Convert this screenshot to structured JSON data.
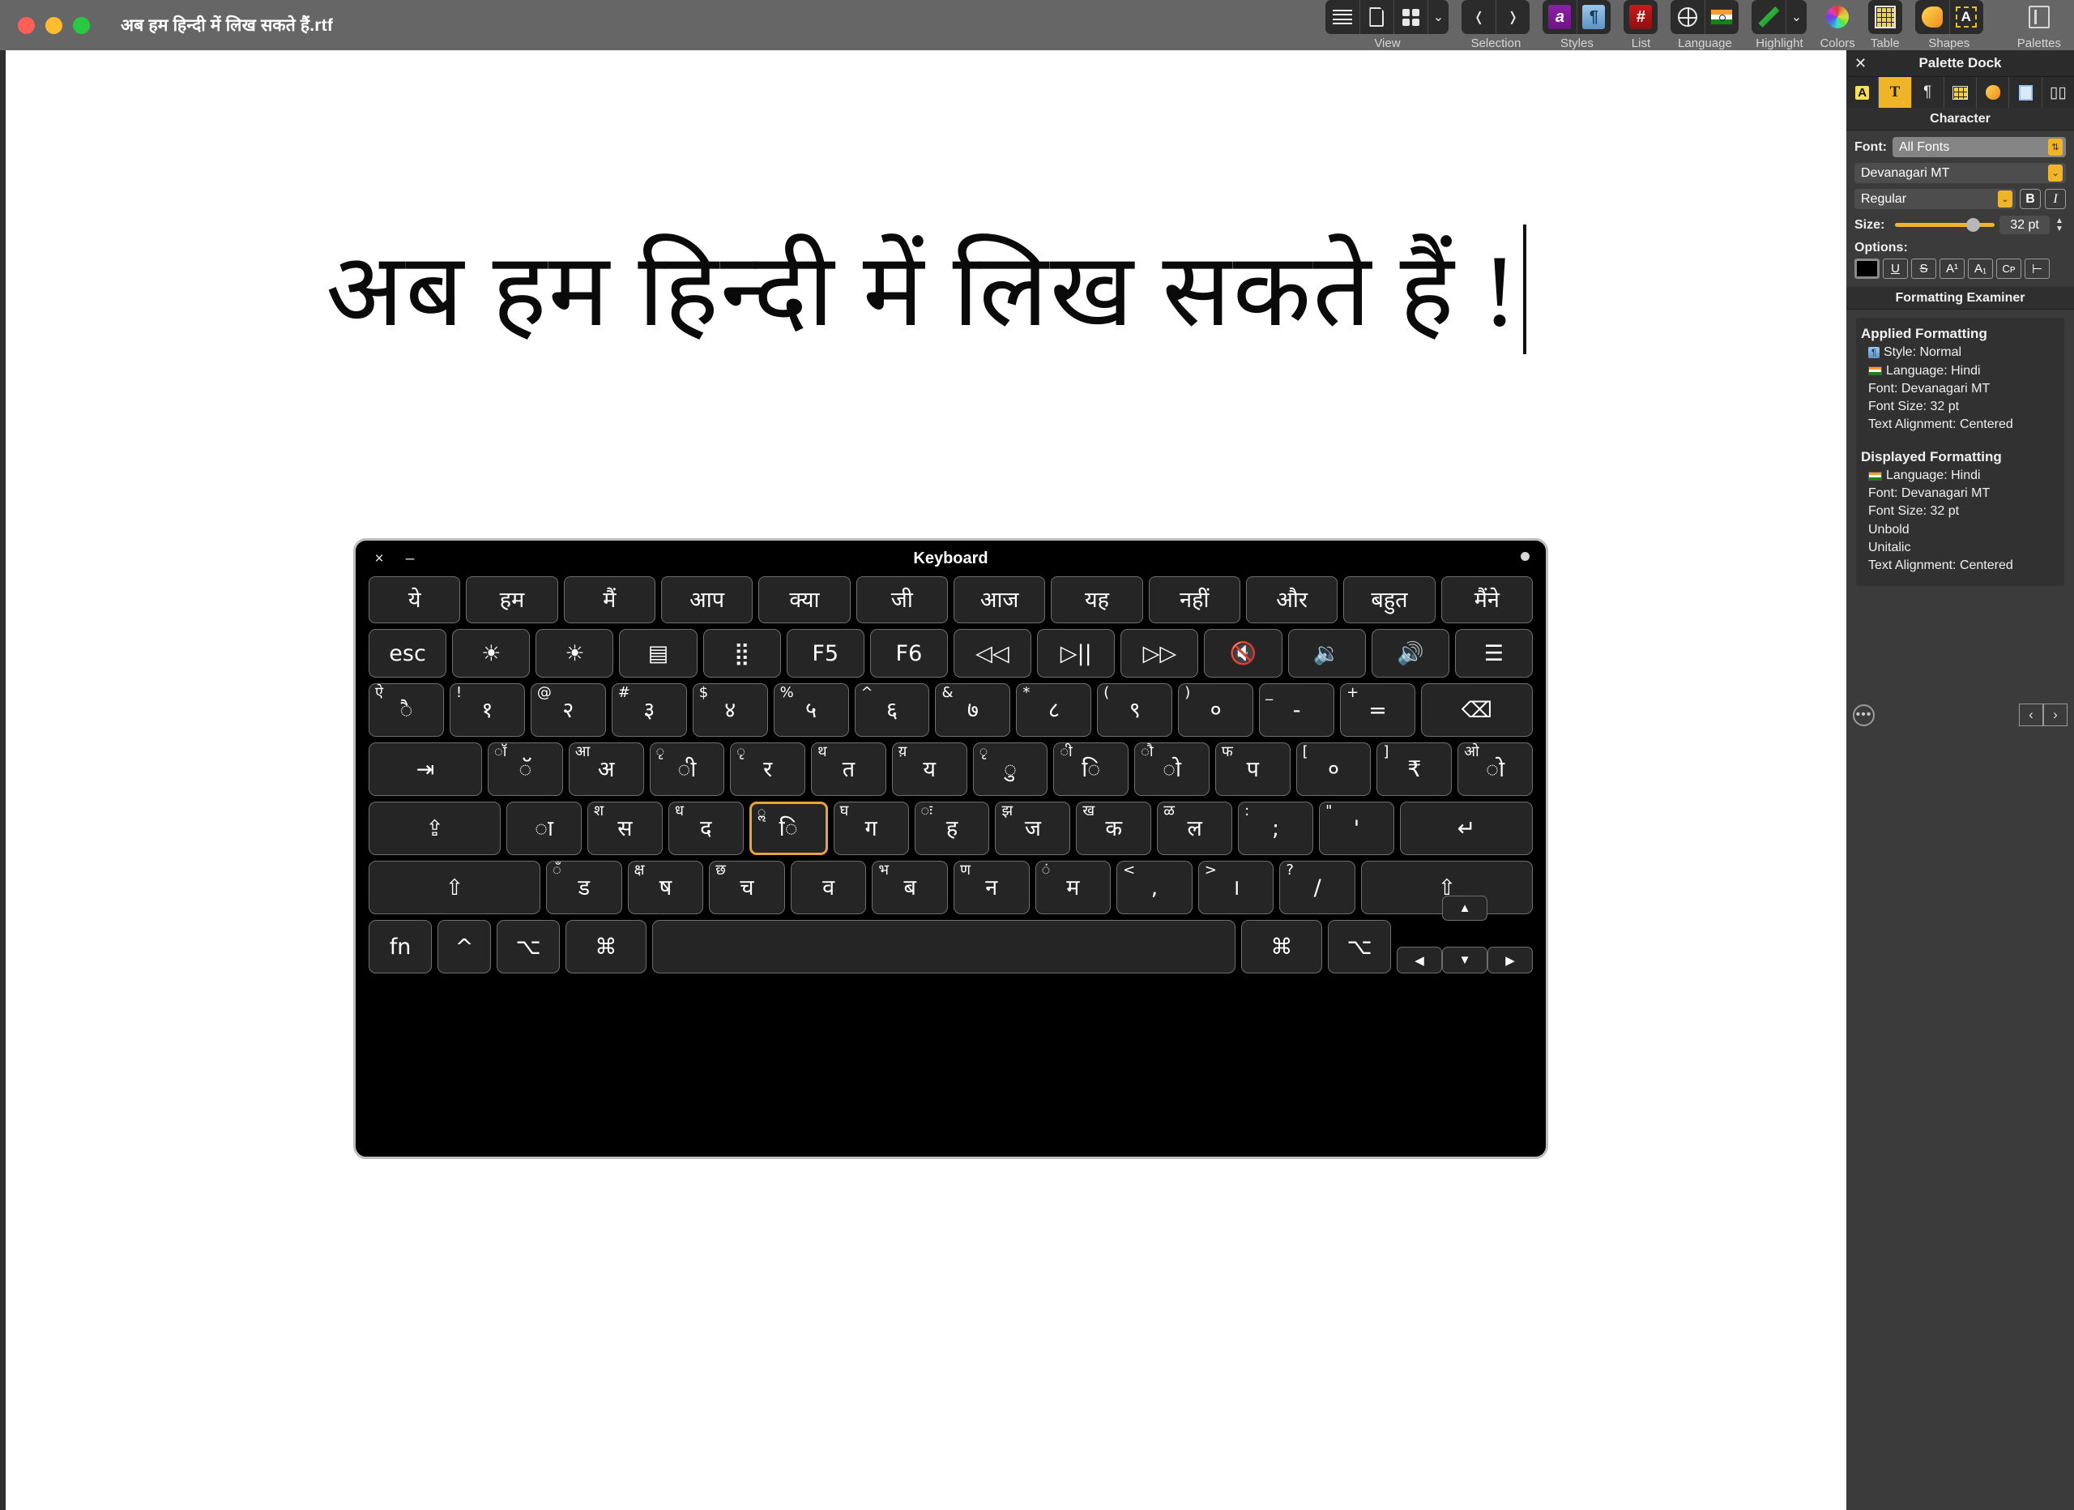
{
  "window": {
    "document_title": "अब हम हिन्दी में लिख सकते हैं.rtf",
    "traffic_lights": [
      "close-red",
      "minimize-yellow",
      "zoom-green"
    ]
  },
  "toolbar": {
    "groups": [
      {
        "label": "View",
        "icons": [
          "list-view-icon",
          "page-view-icon",
          "thumbnail-view-icon",
          "chevron-down-icon"
        ]
      },
      {
        "label": "Selection",
        "icons": [
          "previous-selection-icon",
          "next-selection-icon"
        ]
      },
      {
        "label": "Styles",
        "icons": [
          "character-style-icon",
          "paragraph-style-icon"
        ]
      },
      {
        "label": "List",
        "icons": [
          "list-hash-icon"
        ]
      },
      {
        "label": "Language",
        "icons": [
          "globe-icon",
          "india-flag-icon"
        ]
      },
      {
        "label": "Highlight",
        "icons": [
          "highlight-pen-icon",
          "chevron-down-icon"
        ]
      },
      {
        "label": "Colors",
        "icons": [
          "color-wheel-icon"
        ]
      },
      {
        "label": "Table",
        "icons": [
          "table-grid-icon"
        ]
      },
      {
        "label": "Shapes",
        "icons": [
          "shape-icon",
          "text-box-icon"
        ]
      },
      {
        "label": "Palettes",
        "icons": [
          "palette-dock-icon"
        ]
      }
    ]
  },
  "document": {
    "text": "अब हम हिन्दी में लिख सकते हैं !",
    "caret_visible": true
  },
  "keyboard": {
    "title": "Keyboard",
    "close_label": "×",
    "minimize_label": "–",
    "suggestions": [
      "ये",
      "हम",
      "मैं",
      "आप",
      "क्या",
      "जी",
      "आज",
      "यह",
      "नहीं",
      "और",
      "बहुत",
      "मैंने"
    ],
    "function_row": [
      {
        "main": "esc",
        "name": "esc-key"
      },
      {
        "main": "☀",
        "name": "brightness-down-key"
      },
      {
        "main": "☀",
        "name": "brightness-up-key"
      },
      {
        "main": "▤",
        "name": "mission-control-key"
      },
      {
        "main": "⣿",
        "name": "launchpad-key"
      },
      {
        "main": "F5",
        "name": "f5-key"
      },
      {
        "main": "F6",
        "name": "f6-key"
      },
      {
        "main": "◁◁",
        "name": "rewind-key"
      },
      {
        "main": "▷||",
        "name": "play-pause-key"
      },
      {
        "main": "▷▷",
        "name": "fast-forward-key"
      },
      {
        "main": "🔇",
        "name": "mute-key"
      },
      {
        "main": "🔉",
        "name": "volume-down-key"
      },
      {
        "main": "🔊",
        "name": "volume-up-key"
      },
      {
        "main": "☰",
        "name": "siri-list-key"
      }
    ],
    "number_row": [
      {
        "shifted": "ऐ",
        "main": "ै",
        "name": "key-backtick"
      },
      {
        "shifted": "!",
        "main": "१",
        "name": "key-1"
      },
      {
        "shifted": "@",
        "main": "२",
        "name": "key-2"
      },
      {
        "shifted": "#",
        "main": "३",
        "name": "key-3"
      },
      {
        "shifted": "$",
        "main": "४",
        "name": "key-4"
      },
      {
        "shifted": "%",
        "main": "५",
        "name": "key-5"
      },
      {
        "shifted": "^",
        "main": "६",
        "name": "key-6"
      },
      {
        "shifted": "&",
        "main": "७",
        "name": "key-7"
      },
      {
        "shifted": "*",
        "main": "८",
        "name": "key-8"
      },
      {
        "shifted": "(",
        "main": "९",
        "name": "key-9"
      },
      {
        "shifted": ")",
        "main": "०",
        "name": "key-0"
      },
      {
        "shifted": "_",
        "main": "-",
        "name": "key-minus"
      },
      {
        "shifted": "+",
        "main": "=",
        "name": "key-equals"
      },
      {
        "shifted": "",
        "main": "⌫",
        "name": "delete-key"
      }
    ],
    "top_row": [
      {
        "shifted": "",
        "main": "⇥",
        "name": "tab-key"
      },
      {
        "shifted": "ॉ",
        "main": "ॅ",
        "name": "key-q"
      },
      {
        "shifted": "आ",
        "main": "अ",
        "name": "key-w"
      },
      {
        "shifted": "ृ",
        "main": "ी",
        "name": "key-e"
      },
      {
        "shifted": "ृ",
        "main": "र",
        "name": "key-r"
      },
      {
        "shifted": "थ",
        "main": "त",
        "name": "key-t"
      },
      {
        "shifted": "य़",
        "main": "य",
        "name": "key-y"
      },
      {
        "shifted": "ृ",
        "main": "ु",
        "name": "key-u"
      },
      {
        "shifted": "ी",
        "main": "ि",
        "name": "key-i"
      },
      {
        "shifted": "ौ",
        "main": "ो",
        "name": "key-o"
      },
      {
        "shifted": "फ",
        "main": "प",
        "name": "key-p"
      },
      {
        "shifted": "[",
        "main": "०",
        "name": "key-bracket-left"
      },
      {
        "shifted": "]",
        "main": "₹",
        "name": "key-bracket-right"
      },
      {
        "shifted": "ओ",
        "main": "ो",
        "name": "key-backslash"
      }
    ],
    "home_row": [
      {
        "shifted": "",
        "main": "⇪",
        "name": "caps-lock-key"
      },
      {
        "shifted": "",
        "main": "ा",
        "name": "key-a"
      },
      {
        "shifted": "श",
        "main": "स",
        "name": "key-s"
      },
      {
        "shifted": "ध",
        "main": "द",
        "name": "key-d"
      },
      {
        "shifted": "ॢ",
        "main": "ि",
        "name": "key-f",
        "selected": true
      },
      {
        "shifted": "घ",
        "main": "ग",
        "name": "key-g"
      },
      {
        "shifted": "ः",
        "main": "ह",
        "name": "key-h"
      },
      {
        "shifted": "झ",
        "main": "ज",
        "name": "key-j"
      },
      {
        "shifted": "ख",
        "main": "क",
        "name": "key-k"
      },
      {
        "shifted": "ळ",
        "main": "ल",
        "name": "key-l"
      },
      {
        "shifted": ":",
        "main": ";",
        "name": "key-semicolon"
      },
      {
        "shifted": "\"",
        "main": "'",
        "name": "key-quote"
      },
      {
        "shifted": "",
        "main": "↵",
        "name": "return-key"
      }
    ],
    "bottom_row": [
      {
        "shifted": "",
        "main": "⇧",
        "name": "shift-left-key"
      },
      {
        "shifted": "ँ",
        "main": "ड",
        "name": "key-z"
      },
      {
        "shifted": "क्ष",
        "main": "ष",
        "name": "key-x"
      },
      {
        "shifted": "छ",
        "main": "च",
        "name": "key-c"
      },
      {
        "shifted": "",
        "main": "व",
        "name": "key-v"
      },
      {
        "shifted": "भ",
        "main": "ब",
        "name": "key-b"
      },
      {
        "shifted": "ण",
        "main": "न",
        "name": "key-n"
      },
      {
        "shifted": "ं",
        "main": "म",
        "name": "key-m"
      },
      {
        "shifted": "<",
        "main": ",",
        "name": "key-comma"
      },
      {
        "shifted": ">",
        "main": "।",
        "name": "key-period"
      },
      {
        "shifted": "?",
        "main": "/",
        "name": "key-slash"
      },
      {
        "shifted": "",
        "main": "⇧",
        "name": "shift-right-key"
      }
    ],
    "modifier_row": [
      {
        "main": "fn",
        "name": "fn-key"
      },
      {
        "main": "^",
        "name": "control-key"
      },
      {
        "main": "⌥",
        "name": "option-left-key"
      },
      {
        "main": "⌘",
        "name": "command-left-key"
      },
      {
        "main": "",
        "name": "space-key"
      },
      {
        "main": "⌘",
        "name": "command-right-key"
      },
      {
        "main": "⌥",
        "name": "option-right-key"
      }
    ],
    "arrows": {
      "up": "▲",
      "left": "◀",
      "down": "▼",
      "right": "▶"
    }
  },
  "dock": {
    "title": "Palette Dock",
    "close_label": "✕",
    "tabs": [
      {
        "icon": "text-selection-icon",
        "active": false
      },
      {
        "icon": "character-icon",
        "active": true
      },
      {
        "icon": "paragraph-icon",
        "active": false
      },
      {
        "icon": "table-icon",
        "active": false
      },
      {
        "icon": "shapes-icon",
        "active": false
      },
      {
        "icon": "document-icon",
        "active": false
      },
      {
        "icon": "book-icon",
        "active": false
      }
    ],
    "character": {
      "section_title": "Character",
      "font_label": "Font:",
      "font_collection": "All Fonts",
      "font_family": "Devanagari MT",
      "font_style": "Regular",
      "bold_label": "B",
      "italic_label": "I",
      "size_label": "Size:",
      "size_value": "32 pt",
      "options_label": "Options:",
      "options": [
        "color-swatch",
        "U",
        "S",
        "A¹",
        "A₁",
        "Cᴘ",
        "⊢"
      ]
    },
    "formatting_examiner": {
      "section_title": "Formatting Examiner",
      "applied": {
        "heading": "Applied Formatting",
        "lines": [
          {
            "icon": "paragraph-style-icon",
            "text": "Style: Normal"
          },
          {
            "icon": "india-flag-icon",
            "text": "Language: Hindi"
          },
          {
            "icon": "",
            "text": "Font: Devanagari MT"
          },
          {
            "icon": "",
            "text": "Font Size: 32 pt"
          },
          {
            "icon": "",
            "text": "Text Alignment: Centered"
          }
        ]
      },
      "displayed": {
        "heading": "Displayed Formatting",
        "lines": [
          {
            "icon": "india-flag-icon",
            "text": "Language: Hindi"
          },
          {
            "icon": "",
            "text": "Font: Devanagari MT"
          },
          {
            "icon": "",
            "text": "Font Size: 32 pt"
          },
          {
            "icon": "",
            "text": "Unbold"
          },
          {
            "icon": "",
            "text": "Unitalic"
          },
          {
            "icon": "",
            "text": "Text Alignment: Centered"
          }
        ]
      }
    },
    "footer": {
      "more_label": "•••",
      "prev_label": "‹",
      "next_label": "›"
    }
  },
  "colors": {
    "accent_yellow": "#f0b429",
    "selected_key_border": "#e8a33d",
    "window_chrome": "#666666",
    "dock_bg": "#3b3b3b",
    "keyboard_bg": "#000000"
  }
}
